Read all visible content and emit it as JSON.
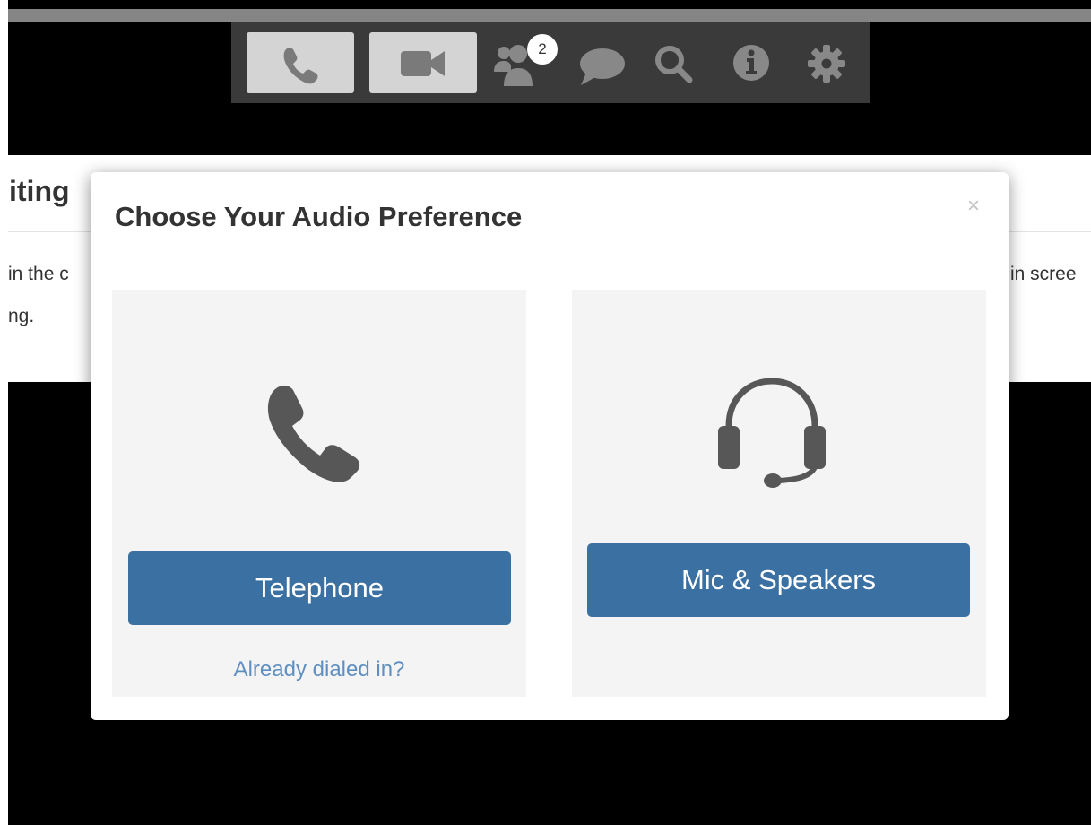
{
  "toolbar": {
    "buttons": [
      {
        "name": "phone-button",
        "icon": "phone-icon"
      },
      {
        "name": "video-button",
        "icon": "video-camera-icon"
      }
    ],
    "participants_icon": "users-icon",
    "participants_count": "2",
    "chat_icon": "chat-bubble-icon",
    "search_icon": "search-icon",
    "info_icon": "info-icon",
    "settings_icon": "gear-icon"
  },
  "background": {
    "heading_fragment": "iting",
    "line1_left": "in the c",
    "line1_right": "in scree",
    "line2_left": "ng."
  },
  "modal": {
    "title": "Choose Your Audio Preference",
    "close_glyph": "×",
    "options": [
      {
        "icon": "phone-icon",
        "button_label": "Telephone",
        "link": "Already dialed in?"
      },
      {
        "icon": "headset-icon",
        "button_label": "Mic & Speakers"
      }
    ]
  },
  "colors": {
    "primary_button": "#3b70a3",
    "link": "#5f8fc1",
    "toolbar_bg": "#3a3a3a",
    "toolbar_icon": "#888888",
    "card_bg": "#f4f4f4"
  }
}
